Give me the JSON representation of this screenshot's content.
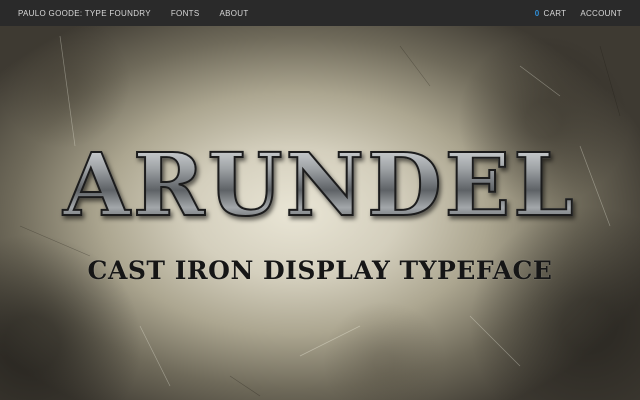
{
  "nav": {
    "brand": "PAULO GOODE: TYPE FOUNDRY",
    "links": [
      "FONTS",
      "ABOUT"
    ],
    "cart_count": "0",
    "cart_label": "CART",
    "account_label": "ACCOUNT"
  },
  "hero": {
    "title": "ARUNDEL",
    "subtitle": "CAST IRON DISPLAY TYPEFACE"
  },
  "colors": {
    "navbar_bg": "#2a2a2a",
    "cart_count": "#2f8fd8"
  }
}
